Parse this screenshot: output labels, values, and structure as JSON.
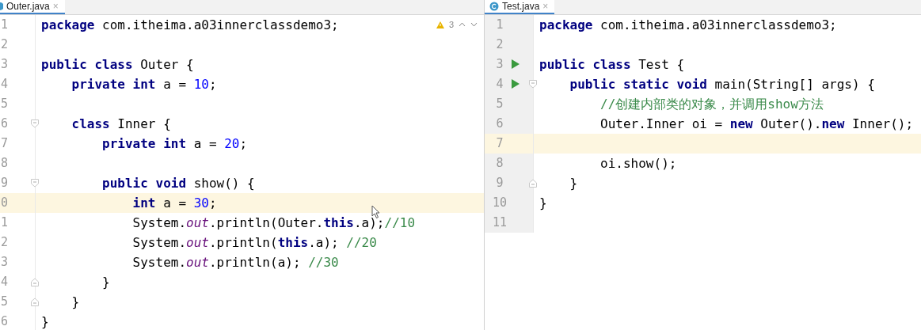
{
  "editors": [
    {
      "tab": {
        "title": "Outer.java",
        "close": "×",
        "selected": true
      },
      "inspection": {
        "count": "3"
      },
      "lines": [
        {
          "number": "1",
          "code": "**package** com.itheima.a03innerclassdemo3;"
        },
        {
          "number": "2"
        },
        {
          "number": "3",
          "code": "**public class** Outer {"
        },
        {
          "number": "4",
          "code": "    **private int** a = 10;"
        },
        {
          "number": "5"
        },
        {
          "number": "6",
          "fold_start": true,
          "code": "    **class** Inner {"
        },
        {
          "number": "7",
          "code": "        **private int** a = 20;"
        },
        {
          "number": "8"
        },
        {
          "number": "9",
          "fold_start": true,
          "code": "        **public void** show() {"
        },
        {
          "number": "0",
          "current": true,
          "code": "            **int** a = 30;"
        },
        {
          "number": "1",
          "code": "            System.*out*.println(Outer.**this**.a);",
          "comment": "//10"
        },
        {
          "number": "2",
          "code": "            System.*out*.println(**this**.a); ",
          "comment": "//20"
        },
        {
          "number": "3",
          "code": "            System.*out*.println(a); ",
          "comment": "//30"
        },
        {
          "number": "4",
          "fold_end": true,
          "code": "        }"
        },
        {
          "number": "5",
          "fold_end": true,
          "code": "    }"
        },
        {
          "number": "6",
          "code": "}"
        }
      ]
    },
    {
      "tab": {
        "title": "Test.java",
        "close": "×",
        "selected": true
      },
      "lines": [
        {
          "number": "1",
          "code": "**package** com.itheima.a03innerclassdemo3;"
        },
        {
          "number": "2"
        },
        {
          "number": "3",
          "run": true,
          "code": "**public class** Test {"
        },
        {
          "number": "4",
          "run": true,
          "fold_start": true,
          "code": "    **public static void** main(String[] args) {"
        },
        {
          "number": "5",
          "comment": "        //创建内部类的对象，并调用show方法"
        },
        {
          "number": "6",
          "code": "        Outer.Inner oi = **new** Outer().**new** Inner();"
        },
        {
          "number": "7",
          "current": true
        },
        {
          "number": "8",
          "code": "        oi.show();"
        },
        {
          "number": "9",
          "fold_end": true,
          "code": "    }"
        },
        {
          "number": "10",
          "code": "}"
        },
        {
          "number": "11"
        }
      ]
    }
  ]
}
